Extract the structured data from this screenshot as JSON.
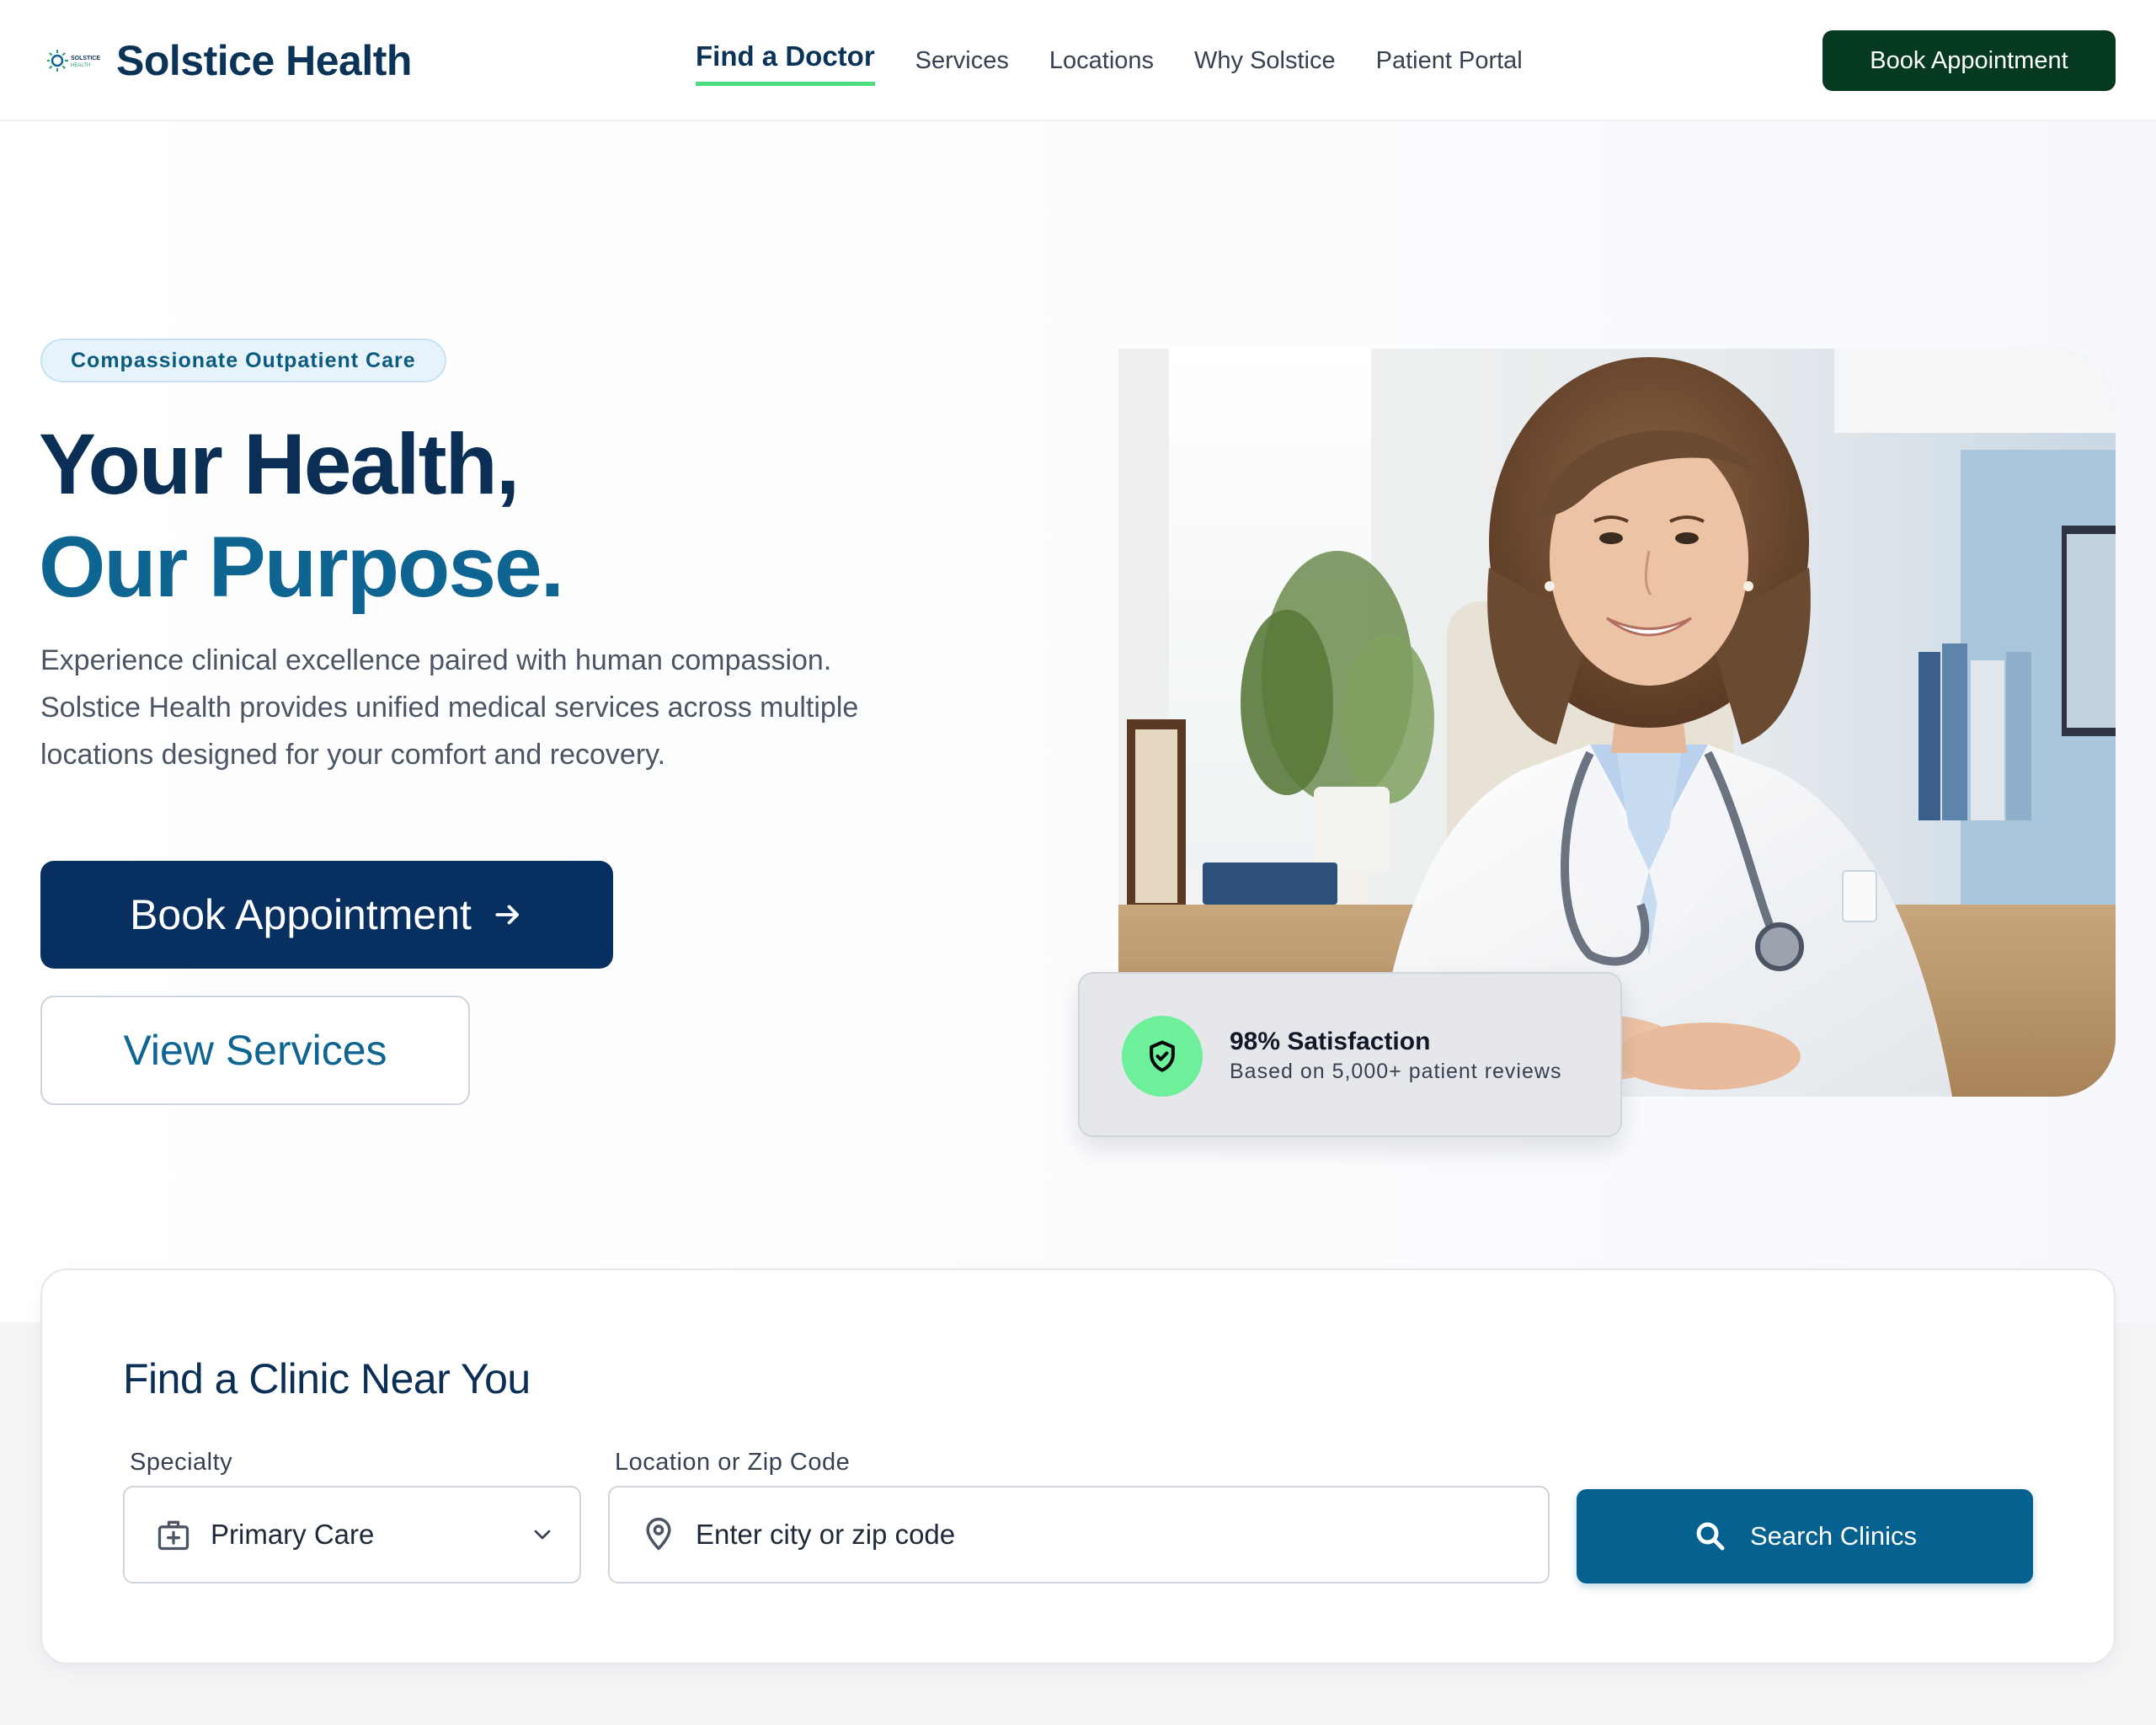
{
  "brand": {
    "name": "Solstice Health",
    "logo_text_top": "SOLSTICE",
    "logo_text_bottom": "HEALTH"
  },
  "nav": {
    "items": [
      {
        "label": "Find a Doctor",
        "active": true
      },
      {
        "label": "Services"
      },
      {
        "label": "Locations"
      },
      {
        "label": "Why Solstice"
      },
      {
        "label": "Patient Portal"
      }
    ],
    "cta_label": "Book Appointment"
  },
  "hero": {
    "badge": "Compassionate Outpatient Care",
    "title_line1": "Your Health,",
    "title_line2": "Our Purpose.",
    "description": "Experience clinical excellence paired with human compassion. Solstice Health provides unified medical services across multiple locations designed for your comfort and recovery.",
    "primary_button": "Book Appointment",
    "secondary_button": "View Services",
    "photo_alt": "Smiling doctor in white coat with stethoscope at desk"
  },
  "stat": {
    "title": "98% Satisfaction",
    "subtitle": "Based on 5,000+ patient reviews",
    "icon": "shield-check-icon"
  },
  "finder": {
    "title": "Find a Clinic Near You",
    "specialty_label": "Specialty",
    "specialty_value": "Primary Care",
    "location_label": "Location or Zip Code",
    "location_placeholder": "Enter city or zip code",
    "search_button": "Search Clinics"
  },
  "colors": {
    "navy": "#0b2e55",
    "teal": "#0e6592",
    "accent_green": "#4ade80",
    "header_cta": "#053a20",
    "search_button": "#05618f"
  }
}
